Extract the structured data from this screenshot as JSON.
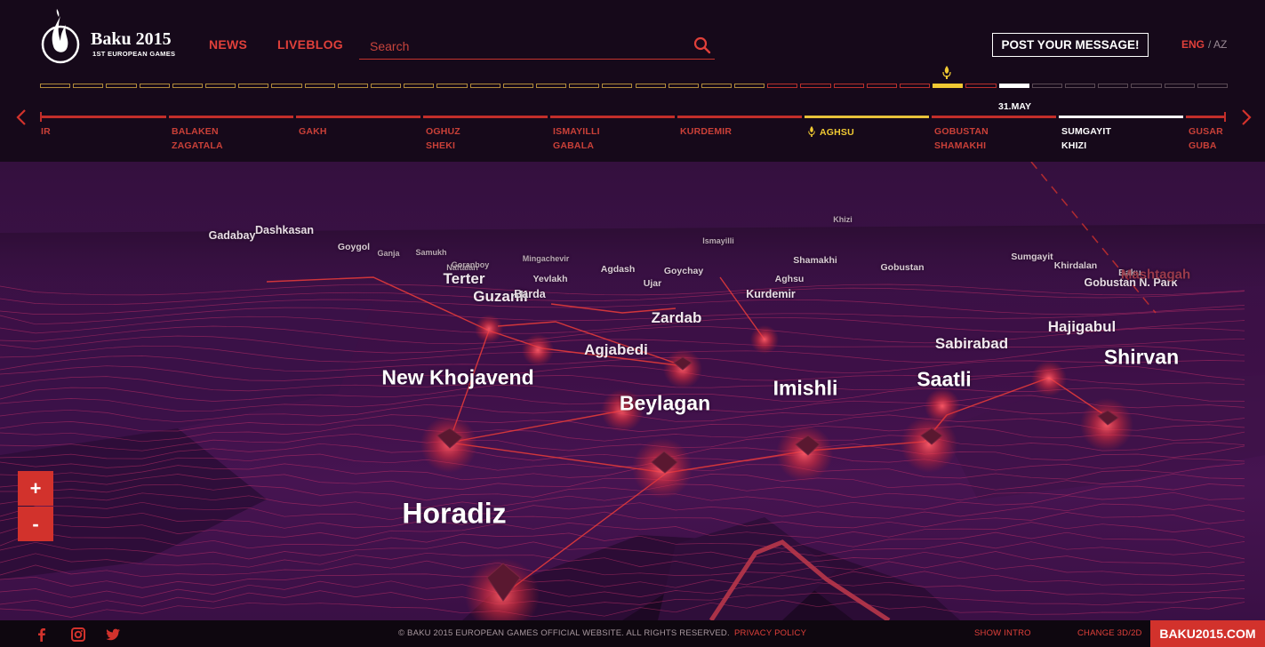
{
  "header": {
    "logo_title": "Baku 2015",
    "logo_subtitle": "1ST EUROPEAN GAMES",
    "nav": [
      {
        "label": "NEWS"
      },
      {
        "label": "LIVEBLOG"
      }
    ],
    "search_placeholder": "Search",
    "post_button": "POST YOUR MESSAGE!",
    "lang_eng": "ENG",
    "lang_separator": "/",
    "lang_az": "AZ"
  },
  "timeline": {
    "progress_segments_total": 36,
    "progress_segments_passed": 27,
    "progress_current_index": 27,
    "current_date": "31.MAY",
    "stops": [
      {
        "line1": "IR",
        "line2": ""
      },
      {
        "line1": "BALAKEN",
        "line2": "ZAGATALA"
      },
      {
        "line1": "GAKH",
        "line2": ""
      },
      {
        "line1": "OGHUZ",
        "line2": "SHEKI"
      },
      {
        "line1": "ISMAYILLI",
        "line2": "GABALA"
      },
      {
        "line1": "KURDEMIR",
        "line2": ""
      },
      {
        "line1": "AGHSU",
        "line2": ""
      },
      {
        "line1": "GOBUSTAN",
        "line2": "SHAMAKHI"
      },
      {
        "line1": "SUMGAYIT",
        "line2": "KHIZI"
      },
      {
        "line1": "GUSAR",
        "line2": "GUBA"
      }
    ]
  },
  "map": {
    "places": [
      {
        "name": "Horadiz",
        "size": "xl"
      },
      {
        "name": "New Khojavend",
        "size": "lg"
      },
      {
        "name": "Beylagan",
        "size": "lg"
      },
      {
        "name": "Imishli",
        "size": "lg"
      },
      {
        "name": "Saatli",
        "size": "lg"
      },
      {
        "name": "Shirvan",
        "size": "lg"
      },
      {
        "name": "Agjabedi",
        "size": "md"
      },
      {
        "name": "Sabirabad",
        "size": "md"
      },
      {
        "name": "Hajigabul",
        "size": "md"
      },
      {
        "name": "Zardab",
        "size": "md"
      },
      {
        "name": "Guzanli",
        "size": "md"
      },
      {
        "name": "Terter",
        "size": "md"
      },
      {
        "name": "Barda",
        "size": "sm"
      },
      {
        "name": "Kurdemir",
        "size": "sm"
      },
      {
        "name": "Gobustan N. Park",
        "size": "sm"
      },
      {
        "name": "Dashkasan",
        "size": "sm"
      },
      {
        "name": "Gadabay",
        "size": "sm"
      },
      {
        "name": "Goygol",
        "size": "xs"
      },
      {
        "name": "Yevlakh",
        "size": "xs"
      },
      {
        "name": "Ujar",
        "size": "xs"
      },
      {
        "name": "Agdash",
        "size": "xs"
      },
      {
        "name": "Goychay",
        "size": "xs"
      },
      {
        "name": "Aghsu",
        "size": "xs"
      },
      {
        "name": "Shamakhi",
        "size": "xs"
      },
      {
        "name": "Gobustan",
        "size": "xs"
      },
      {
        "name": "Sumgayit",
        "size": "xs"
      },
      {
        "name": "Khirdalan",
        "size": "xs"
      },
      {
        "name": "Baku",
        "size": "xs"
      },
      {
        "name": "Mingachevir",
        "size": "xxs"
      },
      {
        "name": "Naftalan",
        "size": "xxs"
      },
      {
        "name": "Goranboy",
        "size": "xxs"
      },
      {
        "name": "Ganja",
        "size": "xxs"
      },
      {
        "name": "Samukh",
        "size": "xxs"
      },
      {
        "name": "Ismayilli",
        "size": "xxs"
      },
      {
        "name": "Khizi",
        "size": "xxs"
      },
      {
        "name": "Mashtagah",
        "size": "xs"
      }
    ],
    "zoom_in": "+",
    "zoom_out": "-"
  },
  "footer": {
    "copyright": "© BAKU 2015 EUROPEAN GAMES OFFICIAL WEBSITE. ALL RIGHTS RESERVED.",
    "privacy": "PRIVACY POLICY",
    "show_intro": "SHOW INTRO",
    "change_view": "CHANGE 3D/2D",
    "site": "BAKU2015.COM"
  },
  "colors": {
    "accent": "#d2322c",
    "torch": "#f0c933",
    "header_bg": "#16091a",
    "map_bg": "#3a1145"
  }
}
